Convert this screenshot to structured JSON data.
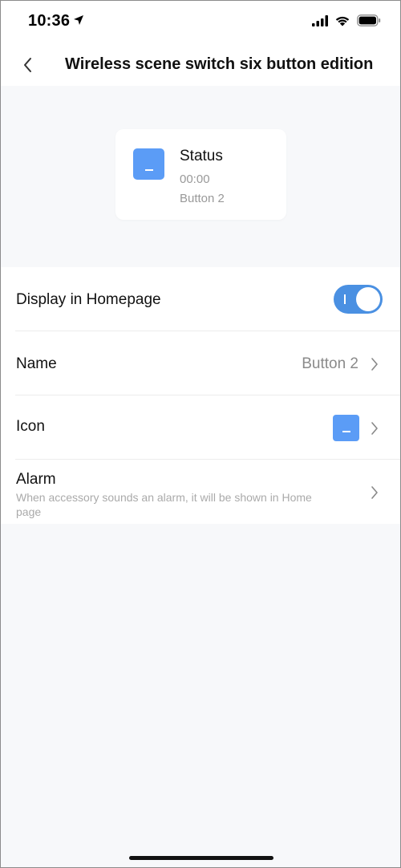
{
  "status_bar": {
    "time": "10:36",
    "icons": [
      "location-arrow-icon",
      "cellular-signal-icon",
      "wifi-icon",
      "battery-icon"
    ]
  },
  "nav": {
    "title": "Wireless scene switch six button edition",
    "back_icon": "chevron-left-icon"
  },
  "card": {
    "title": "Status",
    "time": "00:00",
    "subtitle": "Button 2",
    "icon": "button-tile-icon",
    "icon_color": "#5b9cf6"
  },
  "settings": {
    "display_homepage": {
      "label": "Display in Homepage",
      "enabled": true,
      "toggle_color": "#4a90e2"
    },
    "name": {
      "label": "Name",
      "value": "Button 2"
    },
    "icon": {
      "label": "Icon"
    },
    "alarm": {
      "label": "Alarm",
      "description": "When accessory sounds an alarm, it will be shown in Home page"
    }
  }
}
